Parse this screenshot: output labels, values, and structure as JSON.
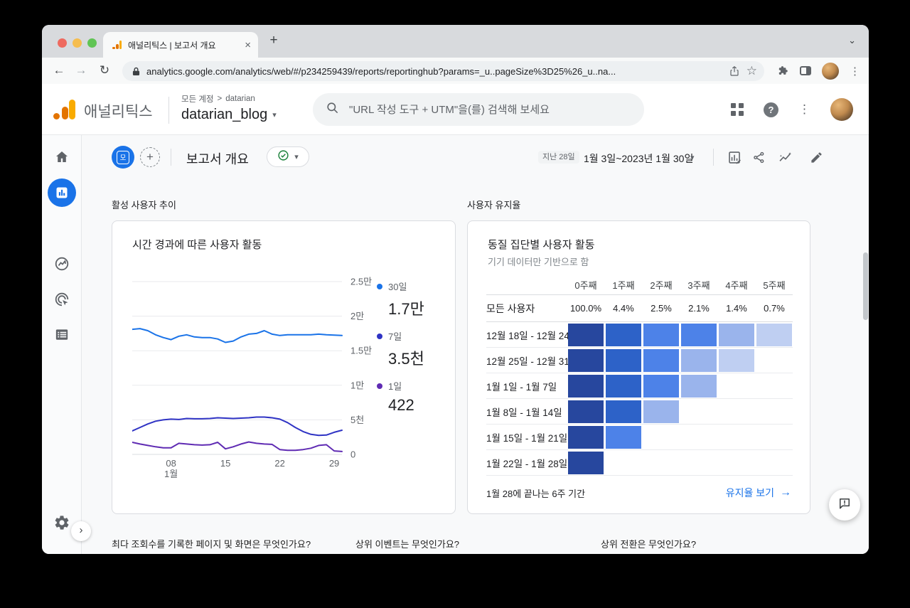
{
  "browser": {
    "tab_title": "애널리틱스 | 보고서 개요",
    "url": "analytics.google.com/analytics/web/#/p234259439/reports/reportinghub?params=_u..pageSize%3D25%26_u..na..."
  },
  "icons": {
    "close": "×",
    "plus": "+",
    "tab_chevron": "⌄",
    "back": "←",
    "forward": "→",
    "reload": "↻",
    "star": "☆",
    "overflow": "⋮",
    "help": "?",
    "caret": "▾",
    "breadcrumb_sep": ">",
    "expand": "›",
    "arrow_right": "→"
  },
  "app_header": {
    "product_name": "애널리틱스",
    "breadcrumb_top": "모든 계정",
    "breadcrumb_account": "datarian",
    "property_name": "datarian_blog",
    "search_placeholder": "\"URL 작성 도구 + UTM\"을(를) 검색해 보세요"
  },
  "report_header": {
    "segment_chip_label": "모",
    "title": "보고서 개요",
    "date_badge": "지난 28일",
    "date_range": "1월 3일~2023년 1월 30일"
  },
  "sections": {
    "active_users_trend": "활성 사용자 추이",
    "user_retention": "사용자 유지율"
  },
  "chart_data": [
    {
      "type": "line",
      "title": "시간 경과에 따른 사용자 활동",
      "x_unit": "1월 일자",
      "x_days": [
        3,
        4,
        5,
        6,
        7,
        8,
        9,
        10,
        11,
        12,
        13,
        14,
        15,
        16,
        17,
        18,
        19,
        20,
        21,
        22,
        23,
        24,
        25,
        26,
        27,
        28,
        29,
        30
      ],
      "series": [
        {
          "name": "30일",
          "latest_label": "1.7만",
          "color": "#1a73e8",
          "values": [
            18100,
            18200,
            17900,
            17300,
            16900,
            16600,
            17100,
            17300,
            17000,
            16900,
            16900,
            16700,
            16200,
            16400,
            17000,
            17400,
            17500,
            17900,
            17400,
            17200,
            17300,
            17300,
            17300,
            17300,
            17400,
            17300,
            17250,
            17200
          ]
        },
        {
          "name": "7일",
          "latest_label": "3.5천",
          "color": "#2f33c4",
          "values": [
            3400,
            3900,
            4400,
            4800,
            5000,
            5100,
            5050,
            5200,
            5150,
            5150,
            5200,
            5300,
            5250,
            5200,
            5250,
            5300,
            5400,
            5400,
            5300,
            5100,
            4600,
            3900,
            3300,
            2900,
            2750,
            2800,
            3200,
            3500
          ]
        },
        {
          "name": "1일",
          "latest_label": "422",
          "color": "#5f2bb3",
          "values": [
            1750,
            1500,
            1300,
            1100,
            950,
            950,
            1600,
            1500,
            1400,
            1350,
            1400,
            1750,
            800,
            1100,
            1500,
            1800,
            1600,
            1500,
            1450,
            700,
            600,
            600,
            700,
            900,
            1300,
            1400,
            500,
            422
          ]
        }
      ],
      "ylim": [
        0,
        25000
      ],
      "yticks": [
        {
          "v": 0,
          "label": "0"
        },
        {
          "v": 5000,
          "label": "5천"
        },
        {
          "v": 10000,
          "label": "1만"
        },
        {
          "v": 15000,
          "label": "1.5만"
        },
        {
          "v": 20000,
          "label": "2만"
        },
        {
          "v": 25000,
          "label": "2.5만"
        }
      ],
      "xticks": [
        {
          "x": 8,
          "label": "08",
          "sub": "1월"
        },
        {
          "x": 15,
          "label": "15"
        },
        {
          "x": 22,
          "label": "22"
        },
        {
          "x": 29,
          "label": "29"
        }
      ],
      "grid": true,
      "legend_position": "right"
    },
    {
      "type": "heatmap",
      "title": "동질 집단별 사용자 활동",
      "subtitle": "기기 데이터만 기반으로 함",
      "columns": [
        "0주째",
        "1주째",
        "2주째",
        "3주째",
        "4주째",
        "5주째"
      ],
      "summary_row": {
        "label": "모든 사용자",
        "values": [
          "100.0%",
          "4.4%",
          "2.5%",
          "2.1%",
          "1.4%",
          "0.7%"
        ]
      },
      "rows": [
        {
          "label": "12월 18일 - 12월 24일",
          "cells": [
            5,
            4,
            3,
            3,
            2,
            1
          ]
        },
        {
          "label": "12월 25일 - 12월 31일",
          "cells": [
            5,
            4,
            3,
            2,
            1
          ]
        },
        {
          "label": "1월 1일 - 1월 7일",
          "cells": [
            5,
            4,
            3,
            2
          ]
        },
        {
          "label": "1월 8일 - 1월 14일",
          "cells": [
            5,
            4,
            2
          ]
        },
        {
          "label": "1월 15일 - 1월 21일",
          "cells": [
            5,
            3
          ]
        },
        {
          "label": "1월 22일 - 1월 28일",
          "cells": [
            5
          ]
        }
      ],
      "palette": {
        "5": "#27479e",
        "4": "#2d62c8",
        "3": "#4d82e8",
        "2": "#9ab4ec",
        "1": "#bfcff2"
      },
      "footer": "1월 28에 끝나는 6주 기간",
      "link": "유지율 보기"
    }
  ],
  "bottom_questions": [
    "최다 조회수를 기록한 페이지 및 화면은 무엇인가요?",
    "상위 이벤트는 무엇인가요?",
    "상위 전환은 무엇인가요?"
  ],
  "colors": {
    "accent": "#1a73e8",
    "logo_orange": "#f9ab00",
    "logo_dark_orange": "#e37400",
    "check_green": "#188038"
  }
}
